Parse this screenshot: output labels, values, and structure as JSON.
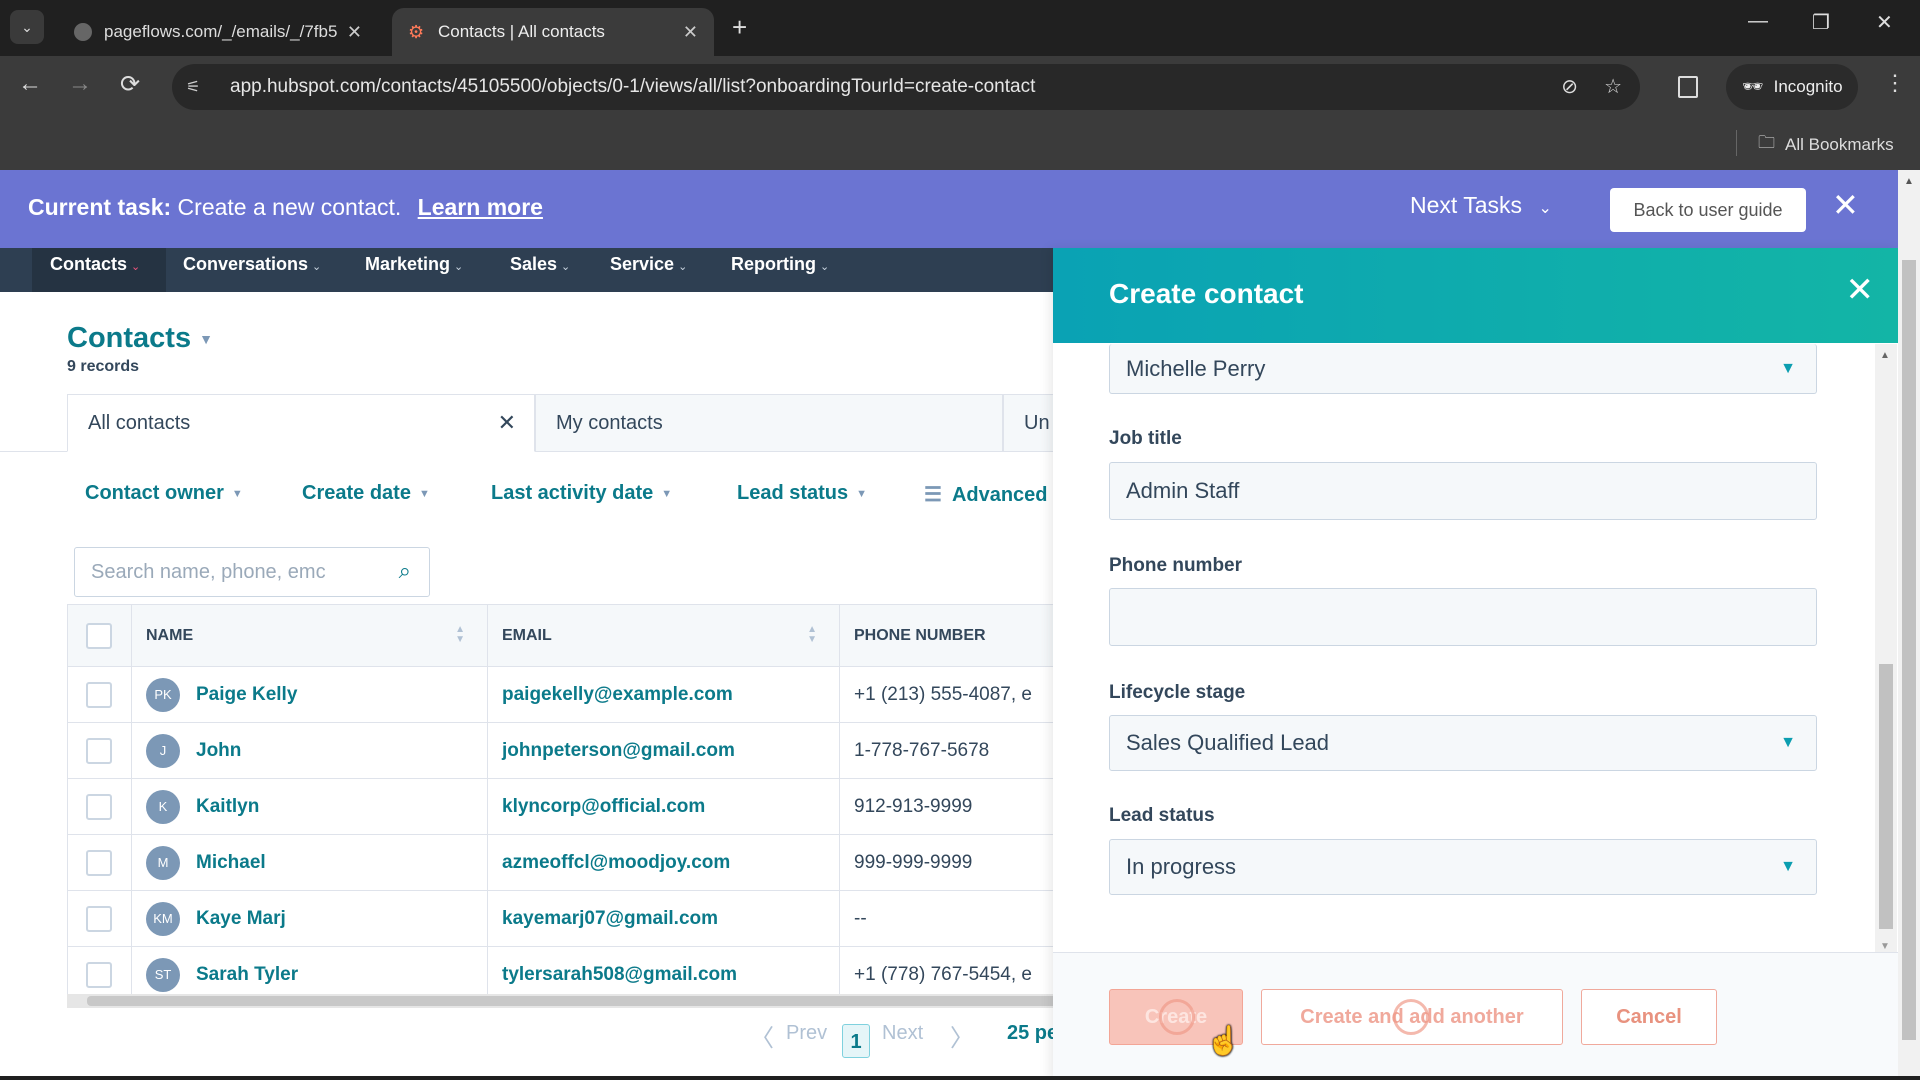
{
  "browser": {
    "tabs": [
      {
        "title": "pageflows.com/_/emails/_/7fb5",
        "active": false,
        "favicon": "globe-icon"
      },
      {
        "title": "Contacts | All contacts",
        "active": true,
        "favicon": "hubspot-icon"
      }
    ],
    "new_tab": "+",
    "url": "app.hubspot.com/contacts/45105500/objects/0-1/views/all/list?onboardingTourId=create-contact",
    "profile": "Incognito",
    "bookmarks_label": "All Bookmarks",
    "icons": {
      "back": "←",
      "forward": "→",
      "reload": "⟳",
      "minimize": "—",
      "restore": "❐",
      "close": "✕",
      "star": "☆",
      "eye_off": "👁",
      "menu": "⋮",
      "tab_dropdown": "⌄"
    }
  },
  "banner": {
    "prefix": "Current task:",
    "task": "Create a new contact.",
    "learn_more": "Learn more",
    "next_tasks": "Next Tasks",
    "back_button": "Back to user guide",
    "close": "✕",
    "color": "#6b74d2"
  },
  "nav": {
    "items": [
      {
        "label": "Contacts"
      },
      {
        "label": "Conversations"
      },
      {
        "label": "Marketing"
      },
      {
        "label": "Sales"
      },
      {
        "label": "Service"
      },
      {
        "label": "Reporting"
      }
    ]
  },
  "page": {
    "title": "Contacts",
    "record_count": "9 records",
    "view_tabs": [
      {
        "label": "All contacts",
        "closable": true
      },
      {
        "label": "My contacts"
      },
      {
        "label": "Un"
      }
    ],
    "filters": [
      {
        "label": "Contact owner"
      },
      {
        "label": "Create date"
      },
      {
        "label": "Last activity date"
      },
      {
        "label": "Lead status"
      },
      {
        "label": "Advanced"
      }
    ],
    "search": {
      "placeholder": "Search name, phone, emc"
    },
    "columns": [
      "NAME",
      "EMAIL",
      "PHONE NUMBER"
    ],
    "rows": [
      {
        "initials": "PK",
        "name": "Paige Kelly",
        "email": "paigekelly@example.com",
        "phone": "+1 (213) 555-4087, e"
      },
      {
        "initials": "J",
        "name": "John",
        "email": "johnpeterson@gmail.com",
        "phone": "1-778-767-5678"
      },
      {
        "initials": "K",
        "name": "Kaitlyn",
        "email": "klyncorp@official.com",
        "phone": "912-913-9999"
      },
      {
        "initials": "M",
        "name": "Michael",
        "email": "azmeoffcl@moodjoy.com",
        "phone": "999-999-9999"
      },
      {
        "initials": "KM",
        "name": "Kaye Marj",
        "email": "kayemarj07@gmail.com",
        "phone": "--"
      },
      {
        "initials": "ST",
        "name": "Sarah Tyler",
        "email": "tylersarah508@gmail.com",
        "phone": "+1 (778) 767-5454, e"
      }
    ],
    "pagination": {
      "prev": "Prev",
      "current": "1",
      "next": "Next",
      "per_page": "25 pe"
    }
  },
  "panel": {
    "title": "Create contact",
    "close": "✕",
    "owner_value": "Michelle Perry",
    "fields": [
      {
        "label": "Job title",
        "value": "Admin Staff",
        "type": "text"
      },
      {
        "label": "Phone number",
        "value": "",
        "type": "text"
      },
      {
        "label": "Lifecycle stage",
        "value": "Sales Qualified Lead",
        "type": "select"
      },
      {
        "label": "Lead status",
        "value": "In progress",
        "type": "select"
      }
    ],
    "buttons": {
      "create": "Create",
      "create_another": "Create and add another",
      "cancel": "Cancel"
    }
  }
}
